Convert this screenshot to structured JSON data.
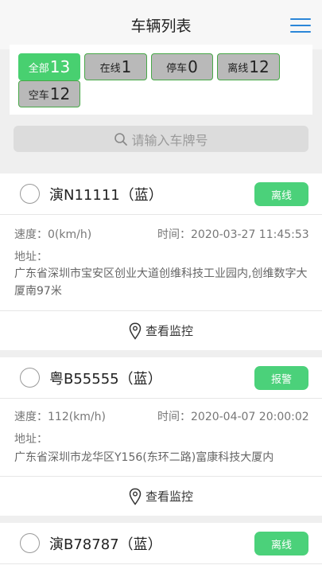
{
  "header": {
    "title": "车辆列表",
    "menu_icon": "hamburger-menu-icon",
    "accent": "#2b86d8"
  },
  "filters": [
    {
      "label": "全部",
      "count": "13",
      "active": true
    },
    {
      "label": "在线",
      "count": "1",
      "active": false
    },
    {
      "label": "停车",
      "count": "0",
      "active": false
    },
    {
      "label": "离线",
      "count": "12",
      "active": false
    },
    {
      "label": "空车",
      "count": "12",
      "active": false
    }
  ],
  "search": {
    "placeholder": "请输入车牌号",
    "icon": "search-icon"
  },
  "labels": {
    "speed": "速度：",
    "time": "时间：",
    "address": "地址：",
    "monitor": "查看监控"
  },
  "vehicles": [
    {
      "plate": "演N11111（蓝）",
      "status": "离线",
      "speed": "0(km/h)",
      "time": "2020-03-27 11:45:53",
      "address": "广东省深圳市宝安区创业大道创维科技工业园内,创维数字大厦南97米"
    },
    {
      "plate": "粤B55555（蓝）",
      "status": "报警",
      "speed": "112(km/h)",
      "time": "2020-04-07 20:00:02",
      "address": "广东省深圳市龙华区Y156(东环二路)富康科技大厦内"
    },
    {
      "plate": "演B78787（蓝）",
      "status": "离线"
    }
  ],
  "colors": {
    "status_green": "#4bd17a",
    "active_chip": "#48d070"
  }
}
